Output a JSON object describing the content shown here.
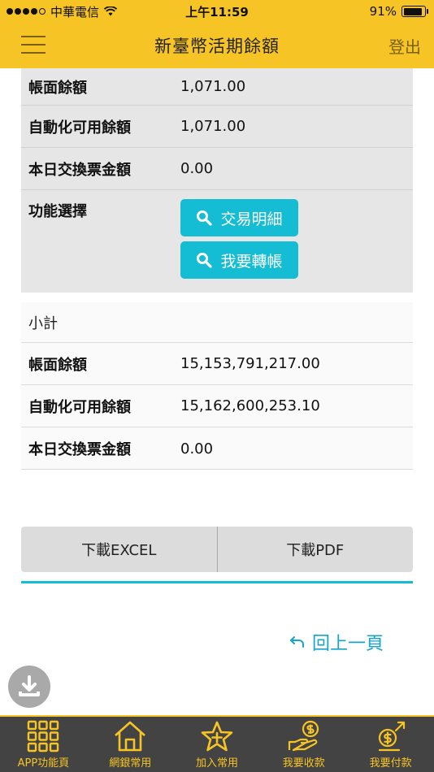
{
  "status_bar": {
    "carrier": "中華電信",
    "time": "上午11:59",
    "battery": "91%",
    "battery_level": 0.91
  },
  "header": {
    "title": "新臺幣活期餘額",
    "logout_label": "登出"
  },
  "account_card": {
    "rows": [
      {
        "label": "帳面餘額",
        "value": "1,071.00"
      },
      {
        "label": "自動化可用餘額",
        "value": "1,071.00"
      },
      {
        "label": "本日交換票金額",
        "value": "0.00"
      }
    ],
    "function_label": "功能選擇",
    "buttons": [
      {
        "label": "交易明細",
        "icon": "search-icon"
      },
      {
        "label": "我要轉帳",
        "icon": "search-icon"
      }
    ]
  },
  "subtotal_card": {
    "title": "小計",
    "rows": [
      {
        "label": "帳面餘額",
        "value": "15,153,791,217.00"
      },
      {
        "label": "自動化可用餘額",
        "value": "15,162,600,253.10"
      },
      {
        "label": "本日交換票金額",
        "value": "0.00"
      }
    ]
  },
  "downloads": {
    "excel_label": "下載EXCEL",
    "pdf_label": "下載PDF"
  },
  "back_link": {
    "label": "回上一頁",
    "icon": "return-arrow-icon"
  },
  "floating_button": {
    "icon": "download-icon"
  },
  "tabbar": {
    "tabs": [
      {
        "label": "APP功能頁",
        "icon": "grid-icon"
      },
      {
        "label": "網銀常用",
        "icon": "home-icon"
      },
      {
        "label": "加入常用",
        "icon": "star-icon"
      },
      {
        "label": "我要收款",
        "icon": "receive-money-icon"
      },
      {
        "label": "我要付款",
        "icon": "pay-money-icon"
      }
    ]
  },
  "colors": {
    "brand_yellow": "#f6c424",
    "accent_cyan": "#14bcd4",
    "tabbar_bg": "#434343"
  }
}
